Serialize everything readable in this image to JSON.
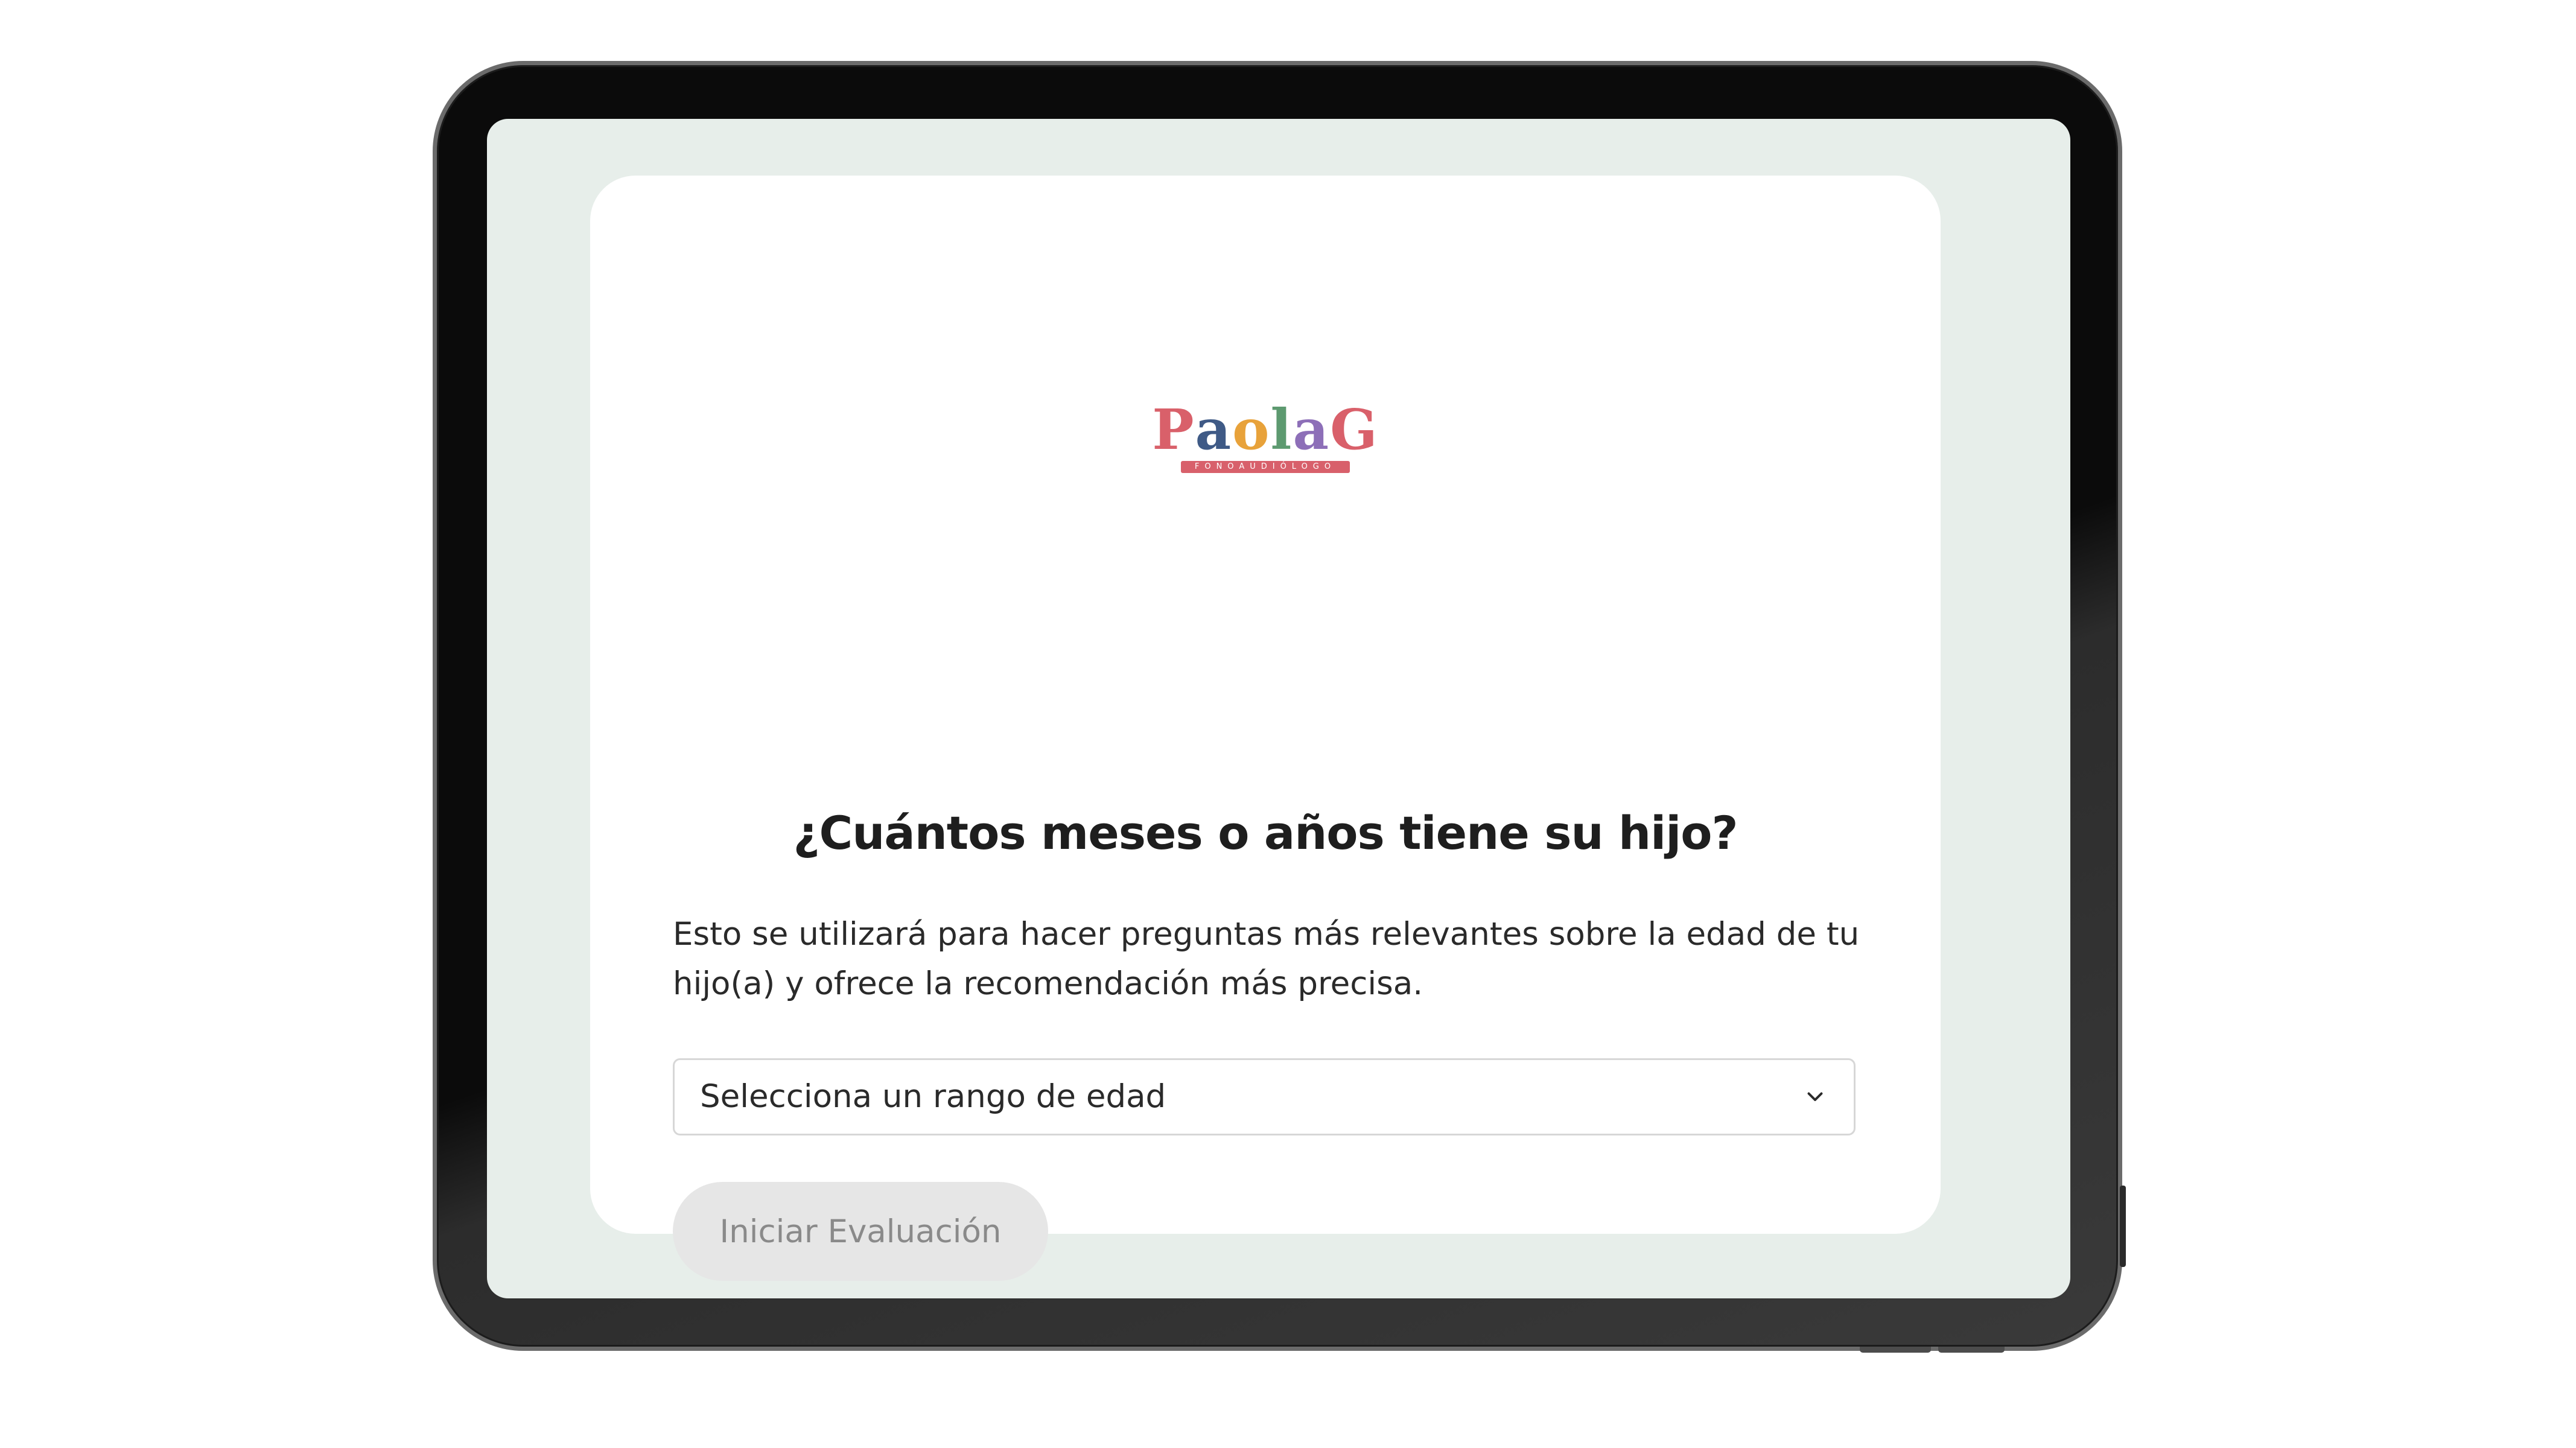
{
  "brand": {
    "name_letters": [
      "P",
      "a",
      "o",
      "l",
      "a",
      "G"
    ],
    "name_colors": [
      "#d9606a",
      "#3f5a86",
      "#e8a23a",
      "#5d9a70",
      "#8d6fb8",
      "#d9606a"
    ],
    "subtitle": "FONOAUDIÓLOGO",
    "subtitle_color": "#d8606b"
  },
  "question": {
    "title": "¿Cuántos meses o años tiene su hijo?",
    "description": "Esto se utilizará para hacer preguntas más relevantes sobre la edad de tu hijo(a) y ofrece la recomendación más precisa."
  },
  "age_select": {
    "selected_label": "Selecciona un rango de edad",
    "icon": "chevron-down-icon"
  },
  "actions": {
    "start_label": "Iniciar Evaluación",
    "start_disabled": true
  },
  "colors": {
    "screen_background": "#e7eeea",
    "card_background": "#ffffff",
    "button_disabled_bg": "#e6e6e6"
  }
}
